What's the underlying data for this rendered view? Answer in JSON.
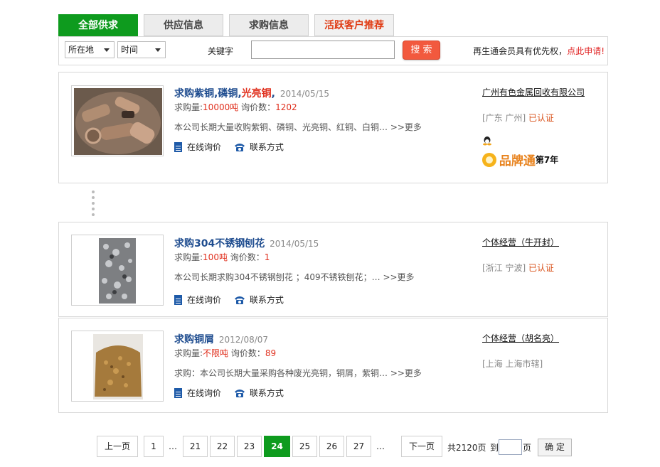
{
  "tabs": [
    {
      "label": "全部供求",
      "active": true
    },
    {
      "label": "供应信息",
      "active": false
    },
    {
      "label": "求购信息",
      "active": false
    },
    {
      "label": "活跃客户推荐",
      "active": false
    }
  ],
  "search": {
    "location_select": "所在地",
    "time_select": "时间",
    "keyword_label": "关键字",
    "keyword_value": "",
    "button_label": "搜 索",
    "promo_text": "再生通会员具有优先权，",
    "promo_link": "点此申请!"
  },
  "listings": [
    {
      "title_parts": [
        "求购紫铜,磷铜,",
        "光亮铜",
        ","
      ],
      "date": "2014/05/15",
      "qty_label": "求购量:",
      "qty_value": "10000吨",
      "inquiry_label": "询价数：",
      "inquiry_value": "1202",
      "description": "本公司长期大量收购紫铜、磷铜、光亮铜、红铜、白铜… >>更多",
      "action_inquiry": "在线询价",
      "action_contact": "联系方式",
      "company": "广州有色金属回收有限公司",
      "location": "[广东 广州]",
      "certified": "已认证",
      "brand_text": "品牌通",
      "brand_years": "第7年"
    },
    {
      "title_parts": [
        "求购304不锈钢刨花"
      ],
      "date": "2014/05/15",
      "qty_label": "求购量:",
      "qty_value": "100吨",
      "inquiry_label": "询价数：",
      "inquiry_value": "1",
      "description": "本公司长期求购304不锈钢刨花 ；409不锈铁刨花；… >>更多",
      "action_inquiry": "在线询价",
      "action_contact": "联系方式",
      "company": "个体经营（牛开封）",
      "location": "[浙江 宁波]",
      "certified": "已认证"
    },
    {
      "title_parts": [
        "求购铜屑"
      ],
      "date": "2012/08/07",
      "qty_label": "求购量:",
      "qty_value": "不限吨",
      "inquiry_label": "询价数：",
      "inquiry_value": "89",
      "description": "求购：本公司长期大量采购各种废光亮铜，铜屑，紫铜… >>更多",
      "action_inquiry": "在线询价",
      "action_contact": "联系方式",
      "company": "个体经营（胡名亮）",
      "location": "[上海 上海市辖]",
      "certified": ""
    }
  ],
  "pagination": {
    "prev": "上一页",
    "first": "1",
    "ellipsis": "…",
    "pages": [
      "21",
      "22",
      "23",
      "24",
      "25",
      "26",
      "27"
    ],
    "current": "24",
    "next": "下一页",
    "total": "共2120页",
    "goto_label": "到",
    "page_unit": "页",
    "confirm": "确 定"
  },
  "colors": {
    "accent_green": "#0e9b1e",
    "link_blue": "#1e4c8f",
    "alert_red": "#e0301e",
    "button_orange": "#f2593e"
  }
}
